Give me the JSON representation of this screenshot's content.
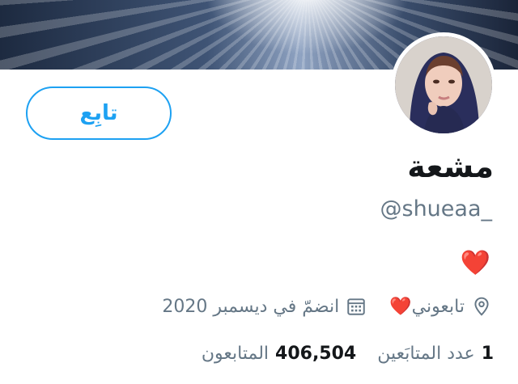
{
  "profile": {
    "display_name": "مشعة",
    "handle": "@shueaa_",
    "bio": "❤️",
    "follow_label": "تابِع"
  },
  "meta": {
    "location": "تابعوني❤️",
    "joined": "انضمّ في ديسمبر 2020"
  },
  "stats": {
    "following_count": "1",
    "following_label": "عدد المتابَعين",
    "followers_count": "406,504",
    "followers_label": "المتابعون"
  },
  "colors": {
    "accent": "#1da1f2",
    "secondary_text": "#657786",
    "primary_text": "#14171a"
  },
  "icons": {
    "location": "map-pin-icon",
    "joined": "calendar-icon"
  }
}
